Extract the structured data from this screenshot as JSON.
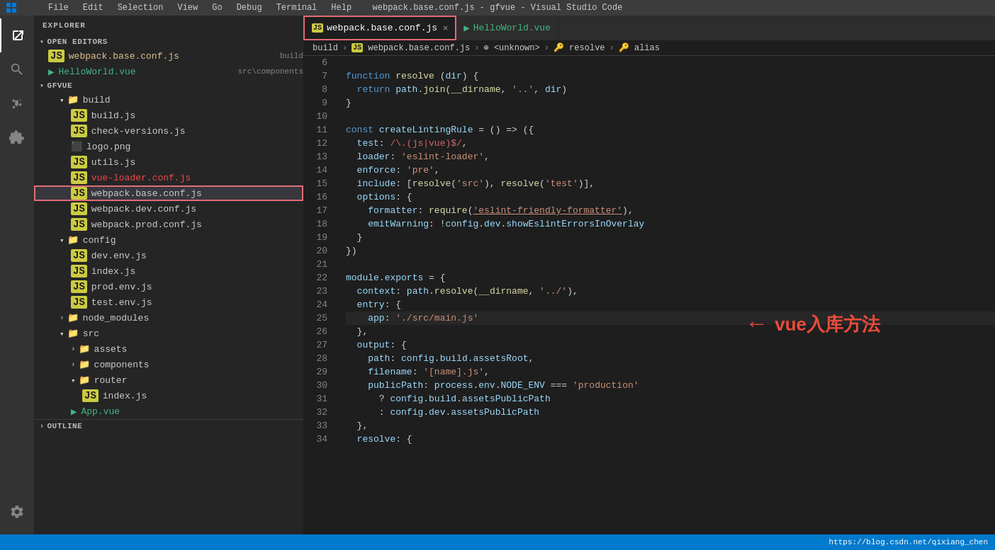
{
  "title_bar": {
    "title": "webpack.base.conf.js - gfvue - Visual Studio Code",
    "menu_items": [
      "File",
      "Edit",
      "Selection",
      "View",
      "Go",
      "Debug",
      "Terminal",
      "Help"
    ]
  },
  "tabs": [
    {
      "id": "webpack-base",
      "icon": "JS",
      "label": "webpack.base.conf.js",
      "active": true,
      "closeable": true,
      "highlighted": true
    },
    {
      "id": "hello-world",
      "icon": "VUE",
      "label": "HelloWorld.vue",
      "active": false,
      "closeable": false,
      "highlighted": false
    }
  ],
  "breadcrumb": {
    "items": [
      "build",
      "webpack.base.conf.js",
      "<unknown>",
      "resolve",
      "alias"
    ]
  },
  "sidebar": {
    "header": "EXPLORER",
    "open_editors": {
      "label": "OPEN EDITORS",
      "items": [
        {
          "icon": "JS",
          "label": "webpack.base.conf.js",
          "tag": "build",
          "modified": true
        },
        {
          "icon": "VUE",
          "label": "HelloWorld.vue",
          "tag": "src\\components"
        }
      ]
    },
    "project": {
      "name": "GFVUE",
      "build_folder": {
        "label": "build",
        "files": [
          {
            "icon": "JS",
            "label": "build.js"
          },
          {
            "icon": "JS",
            "label": "check-versions.js"
          },
          {
            "icon": "IMG",
            "label": "logo.png"
          },
          {
            "icon": "JS",
            "label": "utils.js"
          },
          {
            "icon": "JS",
            "label": "vue-loader.conf.js",
            "deleted": true
          },
          {
            "icon": "JS",
            "label": "webpack.base.conf.js",
            "highlighted": true
          },
          {
            "icon": "JS",
            "label": "webpack.dev.conf.js"
          },
          {
            "icon": "JS",
            "label": "webpack.prod.conf.js"
          }
        ]
      },
      "config_folder": {
        "label": "config",
        "files": [
          {
            "icon": "JS",
            "label": "dev.env.js"
          },
          {
            "icon": "JS",
            "label": "index.js"
          },
          {
            "icon": "JS",
            "label": "prod.env.js"
          },
          {
            "icon": "JS",
            "label": "test.env.js"
          }
        ]
      },
      "node_modules_folder": {
        "label": "node_modules",
        "collapsed": true
      },
      "src_folder": {
        "label": "src",
        "assets_folder": {
          "label": "assets",
          "collapsed": true
        },
        "components_folder": {
          "label": "components",
          "collapsed": true
        },
        "router_folder": {
          "label": "router",
          "expanded": true,
          "files": [
            {
              "icon": "JS",
              "label": "index.js"
            }
          ]
        },
        "app_vue": {
          "icon": "VUE",
          "label": "App.vue"
        }
      }
    },
    "outline": {
      "label": "OUTLINE"
    }
  },
  "code": {
    "lines": [
      {
        "num": 6,
        "text": ""
      },
      {
        "num": 7,
        "tokens": [
          {
            "t": "kw",
            "v": "function "
          },
          {
            "t": "fn",
            "v": "resolve"
          },
          {
            "t": "op",
            "v": " ("
          },
          {
            "t": "light-blue",
            "v": "dir"
          },
          {
            "t": "op",
            "v": ") {"
          }
        ]
      },
      {
        "num": 8,
        "tokens": [
          {
            "t": "",
            "v": "  "
          },
          {
            "t": "kw",
            "v": "return "
          },
          {
            "t": "light-blue",
            "v": "path"
          },
          {
            "t": "op",
            "v": "."
          },
          {
            "t": "fn",
            "v": "join"
          },
          {
            "t": "op",
            "v": "("
          },
          {
            "t": "fn",
            "v": "__dirname"
          },
          {
            "t": "op",
            "v": ", "
          },
          {
            "t": "str",
            "v": "'..'"
          },
          {
            "t": "op",
            "v": ", "
          },
          {
            "t": "light-blue",
            "v": "dir"
          },
          {
            "t": "op",
            "v": ")"
          }
        ]
      },
      {
        "num": 9,
        "tokens": [
          {
            "t": "op",
            "v": "}"
          }
        ]
      },
      {
        "num": 10,
        "text": ""
      },
      {
        "num": 11,
        "tokens": [
          {
            "t": "kw",
            "v": "const "
          },
          {
            "t": "light-blue",
            "v": "createLintingRule"
          },
          {
            "t": "op",
            "v": " = () => ({"
          }
        ]
      },
      {
        "num": 12,
        "tokens": [
          {
            "t": "",
            "v": "  "
          },
          {
            "t": "prop",
            "v": "test"
          },
          {
            "t": "op",
            "v": ": "
          },
          {
            "t": "reg",
            "v": "/\\.(js|vue)$/"
          },
          {
            "t": "op",
            "v": ","
          }
        ]
      },
      {
        "num": 13,
        "tokens": [
          {
            "t": "",
            "v": "  "
          },
          {
            "t": "prop",
            "v": "loader"
          },
          {
            "t": "op",
            "v": ": "
          },
          {
            "t": "str",
            "v": "'eslint-loader'"
          },
          {
            "t": "op",
            "v": ","
          }
        ]
      },
      {
        "num": 14,
        "tokens": [
          {
            "t": "",
            "v": "  "
          },
          {
            "t": "prop",
            "v": "enforce"
          },
          {
            "t": "op",
            "v": ": "
          },
          {
            "t": "str",
            "v": "'pre'"
          },
          {
            "t": "op",
            "v": ","
          }
        ]
      },
      {
        "num": 15,
        "tokens": [
          {
            "t": "",
            "v": "  "
          },
          {
            "t": "prop",
            "v": "include"
          },
          {
            "t": "op",
            "v": ": ["
          },
          {
            "t": "fn",
            "v": "resolve"
          },
          {
            "t": "op",
            "v": "("
          },
          {
            "t": "str",
            "v": "'src'"
          },
          {
            "t": "op",
            "v": "), "
          },
          {
            "t": "fn",
            "v": "resolve"
          },
          {
            "t": "op",
            "v": "("
          },
          {
            "t": "str",
            "v": "'test'"
          },
          {
            "t": "op",
            "v": "')],"
          }
        ]
      },
      {
        "num": 16,
        "tokens": [
          {
            "t": "",
            "v": "  "
          },
          {
            "t": "prop",
            "v": "options"
          },
          {
            "t": "op",
            "v": ": {"
          }
        ]
      },
      {
        "num": 17,
        "tokens": [
          {
            "t": "",
            "v": "    "
          },
          {
            "t": "prop",
            "v": "formatter"
          },
          {
            "t": "op",
            "v": ": "
          },
          {
            "t": "fn",
            "v": "require"
          },
          {
            "t": "op",
            "v": "("
          },
          {
            "t": "str",
            "v": "'eslint-friendly-formatter'"
          },
          {
            "t": "op",
            "v": "),"
          }
        ]
      },
      {
        "num": 18,
        "tokens": [
          {
            "t": "",
            "v": "    "
          },
          {
            "t": "prop",
            "v": "emitWarning"
          },
          {
            "t": "op",
            "v": ": !"
          },
          {
            "t": "light-blue",
            "v": "config"
          },
          {
            "t": "op",
            "v": "."
          },
          {
            "t": "light-blue",
            "v": "dev"
          },
          {
            "t": "op",
            "v": "."
          },
          {
            "t": "light-blue",
            "v": "showEslintErrorsInOverlay"
          }
        ]
      },
      {
        "num": 19,
        "tokens": [
          {
            "t": "",
            "v": "  "
          },
          {
            "t": "op",
            "v": "}"
          }
        ]
      },
      {
        "num": 20,
        "tokens": [
          {
            "t": "op",
            "v": "})"
          }
        ]
      },
      {
        "num": 21,
        "text": ""
      },
      {
        "num": 22,
        "tokens": [
          {
            "t": "light-blue",
            "v": "module"
          },
          {
            "t": "op",
            "v": "."
          },
          {
            "t": "light-blue",
            "v": "exports"
          },
          {
            "t": "op",
            "v": " = {"
          }
        ]
      },
      {
        "num": 23,
        "tokens": [
          {
            "t": "",
            "v": "  "
          },
          {
            "t": "prop",
            "v": "context"
          },
          {
            "t": "op",
            "v": ": "
          },
          {
            "t": "light-blue",
            "v": "path"
          },
          {
            "t": "op",
            "v": "."
          },
          {
            "t": "fn",
            "v": "resolve"
          },
          {
            "t": "op",
            "v": "("
          },
          {
            "t": "fn",
            "v": "__dirname"
          },
          {
            "t": "op",
            "v": ", "
          },
          {
            "t": "str",
            "v": "'../'"
          },
          {
            "t": "op",
            "v": "),"
          }
        ]
      },
      {
        "num": 24,
        "tokens": [
          {
            "t": "",
            "v": "  "
          },
          {
            "t": "prop",
            "v": "entry"
          },
          {
            "t": "op",
            "v": ": {"
          }
        ]
      },
      {
        "num": 25,
        "tokens": [
          {
            "t": "",
            "v": "    "
          },
          {
            "t": "prop",
            "v": "app"
          },
          {
            "t": "op",
            "v": ": "
          },
          {
            "t": "str",
            "v": "'./src/main.js'"
          }
        ]
      },
      {
        "num": 26,
        "tokens": [
          {
            "t": "",
            "v": "  "
          },
          {
            "t": "op",
            "v": "},"
          }
        ]
      },
      {
        "num": 27,
        "tokens": [
          {
            "t": "",
            "v": "  "
          },
          {
            "t": "prop",
            "v": "output"
          },
          {
            "t": "op",
            "v": ": {"
          }
        ]
      },
      {
        "num": 28,
        "tokens": [
          {
            "t": "",
            "v": "    "
          },
          {
            "t": "prop",
            "v": "path"
          },
          {
            "t": "op",
            "v": ": "
          },
          {
            "t": "light-blue",
            "v": "config"
          },
          {
            "t": "op",
            "v": "."
          },
          {
            "t": "light-blue",
            "v": "build"
          },
          {
            "t": "op",
            "v": "."
          },
          {
            "t": "light-blue",
            "v": "assetsRoot"
          },
          {
            "t": "op",
            "v": ","
          }
        ]
      },
      {
        "num": 29,
        "tokens": [
          {
            "t": "",
            "v": "    "
          },
          {
            "t": "prop",
            "v": "filename"
          },
          {
            "t": "op",
            "v": ": "
          },
          {
            "t": "str",
            "v": "'[name].js'"
          },
          {
            "t": "op",
            "v": ","
          }
        ]
      },
      {
        "num": 30,
        "tokens": [
          {
            "t": "",
            "v": "    "
          },
          {
            "t": "prop",
            "v": "publicPath"
          },
          {
            "t": "op",
            "v": ": "
          },
          {
            "t": "light-blue",
            "v": "process"
          },
          {
            "t": "op",
            "v": "."
          },
          {
            "t": "light-blue",
            "v": "env"
          },
          {
            "t": "op",
            "v": "."
          },
          {
            "t": "light-blue",
            "v": "NODE_ENV"
          },
          {
            "t": "op",
            "v": " === "
          },
          {
            "t": "str",
            "v": "'production'"
          }
        ]
      },
      {
        "num": 31,
        "tokens": [
          {
            "t": "",
            "v": "      ? "
          },
          {
            "t": "light-blue",
            "v": "config"
          },
          {
            "t": "op",
            "v": "."
          },
          {
            "t": "light-blue",
            "v": "build"
          },
          {
            "t": "op",
            "v": "."
          },
          {
            "t": "light-blue",
            "v": "assetsPublicPath"
          }
        ]
      },
      {
        "num": 32,
        "tokens": [
          {
            "t": "",
            "v": "      : "
          },
          {
            "t": "light-blue",
            "v": "config"
          },
          {
            "t": "op",
            "v": "."
          },
          {
            "t": "light-blue",
            "v": "dev"
          },
          {
            "t": "op",
            "v": "."
          },
          {
            "t": "light-blue",
            "v": "assetsPublicPath"
          }
        ]
      },
      {
        "num": 33,
        "tokens": [
          {
            "t": "",
            "v": "  "
          },
          {
            "t": "op",
            "v": "},"
          }
        ]
      },
      {
        "num": 34,
        "tokens": [
          {
            "t": "",
            "v": "  "
          },
          {
            "t": "prop",
            "v": "resolve"
          },
          {
            "t": "op",
            "v": ": {"
          }
        ]
      }
    ],
    "annotation": {
      "arrow": "←",
      "text": "vue入库方法"
    }
  },
  "status_bar": {
    "url": "https://blog.csdn.net/qixiang_chen"
  }
}
